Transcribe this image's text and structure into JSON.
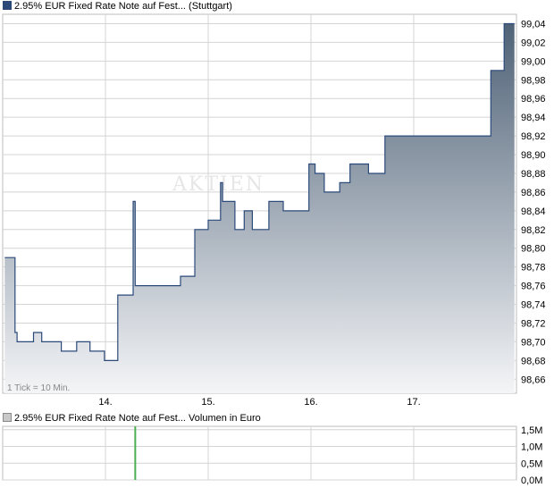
{
  "legend_main": "2.95% EUR Fixed Rate Note auf Fest... (Stuttgart)",
  "legend_volume": "2.95% EUR Fixed Rate Note auf Fest... Volumen in Euro",
  "tick_note": "1 Tick = 10 Min.",
  "watermark": "AKTIEN",
  "colors": {
    "line": "#2b4a7a",
    "fill_top": "#4f6277",
    "fill_bottom": "#f4f5f7",
    "volume_bar": "#4caf50",
    "grid": "#d4d4d4"
  },
  "chart_data": [
    {
      "type": "area",
      "ylim": [
        98.645,
        99.05
      ],
      "y_ticks": [
        "99,04",
        "99,02",
        "99,00",
        "98,98",
        "98,96",
        "98,94",
        "98,92",
        "98,90",
        "98,88",
        "98,86",
        "98,84",
        "98,82",
        "98,80",
        "98,78",
        "98,76",
        "98,74",
        "98,72",
        "98,70",
        "98,68",
        "98,66"
      ],
      "y_tick_values": [
        99.04,
        99.02,
        99.0,
        98.98,
        98.96,
        98.94,
        98.92,
        98.9,
        98.88,
        98.86,
        98.84,
        98.82,
        98.8,
        98.78,
        98.76,
        98.74,
        98.72,
        98.7,
        98.68,
        98.66
      ],
      "x_ticks": [
        "14.",
        "15.",
        "16.",
        "17."
      ],
      "x_tick_days": [
        14,
        15,
        16,
        17
      ],
      "xlim": [
        13.02,
        17.98
      ],
      "grid": true,
      "x": [
        13.02,
        13.12,
        13.14,
        13.17,
        13.3,
        13.38,
        13.5,
        13.57,
        13.72,
        13.85,
        13.87,
        13.99,
        14.12,
        14.14,
        14.27,
        14.29,
        14.32,
        14.34,
        14.73,
        14.87,
        15.0,
        15.1,
        15.12,
        15.14,
        15.16,
        15.26,
        15.35,
        15.43,
        15.53,
        15.59,
        15.73,
        15.83,
        15.98,
        16.04,
        16.11,
        16.13,
        16.28,
        16.38,
        16.56,
        16.72,
        16.84,
        16.95,
        17.72,
        17.75,
        17.86,
        17.88,
        17.98
      ],
      "y": [
        98.79,
        98.71,
        98.7,
        98.7,
        98.71,
        98.7,
        98.7,
        98.69,
        98.7,
        98.69,
        98.69,
        98.68,
        98.75,
        98.75,
        98.85,
        98.76,
        98.76,
        98.76,
        98.77,
        98.82,
        98.83,
        98.83,
        98.87,
        98.85,
        98.85,
        98.82,
        98.84,
        98.82,
        98.82,
        98.85,
        98.84,
        98.84,
        98.89,
        98.88,
        98.88,
        98.86,
        98.87,
        98.89,
        98.88,
        98.92,
        98.92,
        98.92,
        98.92,
        98.99,
        98.99,
        99.04,
        99.04
      ]
    },
    {
      "type": "bar",
      "ylim": [
        0,
        1.6
      ],
      "y_ticks": [
        "1,5M",
        "1,0M",
        "0,5M",
        "0,0M"
      ],
      "y_tick_values": [
        1.5,
        1.0,
        0.5,
        0.0
      ],
      "x_ticks": [
        "14.",
        "15.",
        "16.",
        "17."
      ],
      "bars": [
        {
          "x": 14.29,
          "value": 1.6
        }
      ],
      "grid": true
    }
  ]
}
